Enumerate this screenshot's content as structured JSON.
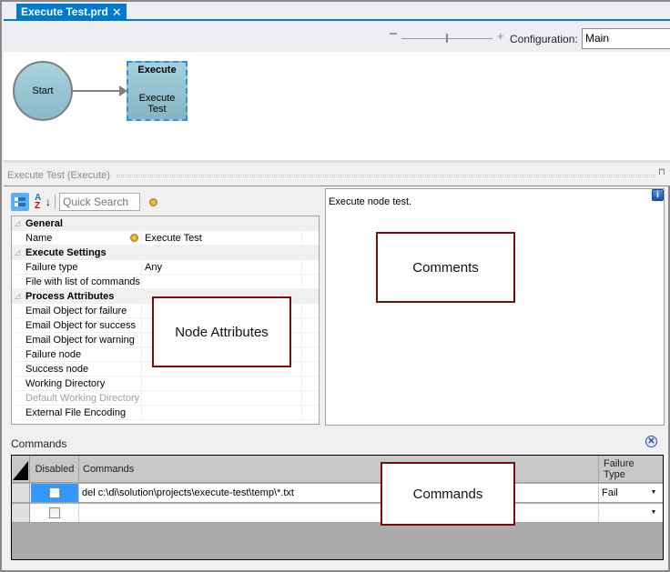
{
  "document_tab": {
    "label": "Execute Test.prd",
    "close_glyph": "✕"
  },
  "designer_toolbar": {
    "zoom_out_icon": "minus",
    "zoom_in_label": "+",
    "zoom_level_fraction": 0.5,
    "configuration_label": "Configuration:",
    "configuration_value": "Main"
  },
  "diagram": {
    "start_node": {
      "label": "Start"
    },
    "execute_node": {
      "type_label": "Execute",
      "name_line1": "Execute",
      "name_line2": "Test"
    }
  },
  "properties_panel": {
    "title": "Execute Test (Execute)",
    "pin_glyph": "⊓",
    "toolbar": {
      "categorized_icon": "categorized-icon",
      "alphabetical_icon": "sort-az-icon",
      "az_top": "A",
      "az_bottom": "Z",
      "az_arrow": "↓",
      "quick_search_placeholder": "Quick Search"
    },
    "groups": [
      {
        "label": "General",
        "rows": [
          {
            "name": "Name",
            "value": "Execute Test",
            "has_icon": true
          }
        ]
      },
      {
        "label": "Execute Settings",
        "rows": [
          {
            "name": "Failure type",
            "value": "Any"
          },
          {
            "name": "File with list of commands",
            "value": ""
          }
        ]
      },
      {
        "label": "Process Attributes",
        "rows": [
          {
            "name": "Email Object for failure",
            "value": ""
          },
          {
            "name": "Email Object for success",
            "value": ""
          },
          {
            "name": "Email Object for warning",
            "value": ""
          },
          {
            "name": "Failure node",
            "value": ""
          },
          {
            "name": "Success node",
            "value": ""
          },
          {
            "name": "Working Directory",
            "value": ""
          },
          {
            "name": "Default Working Directory",
            "value": "",
            "disabled": true
          },
          {
            "name": "External File Encoding",
            "value": ""
          }
        ]
      }
    ],
    "collapse_glyph": "◿",
    "comments": {
      "text": "Execute node test.",
      "info_glyph": "i"
    }
  },
  "callouts": {
    "node_attributes": "Node Attributes",
    "comments": "Comments",
    "commands": "Commands"
  },
  "commands_section": {
    "label": "Commands",
    "clear_glyph": "✕",
    "columns": [
      "Disabled",
      "Commands",
      "Failure\nType"
    ],
    "column_failure_line1": "Failure",
    "column_failure_line2": "Type",
    "rows": [
      {
        "disabled": false,
        "command": "del c:\\di\\solution\\projects\\execute-test\\temp\\*.txt",
        "failure_type": "Fail"
      },
      {
        "disabled": false,
        "command": "",
        "failure_type": ""
      }
    ],
    "dropdown_glyph": "▼"
  }
}
